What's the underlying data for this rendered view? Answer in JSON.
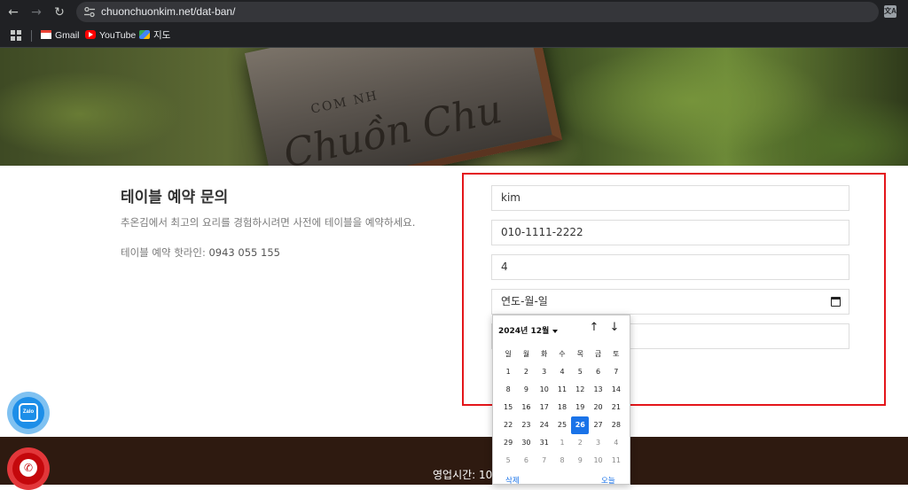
{
  "browser": {
    "url": "chuonchuonkim.net/dat-ban/",
    "translate_glyph": "文A",
    "back_glyph": "←",
    "forward_glyph": "→",
    "reload_glyph": "↻",
    "bookmarks": [
      {
        "label": "Gmail",
        "icon": "gmail-icon"
      },
      {
        "label": "YouTube",
        "icon": "youtube-icon"
      },
      {
        "label": "지도",
        "icon": "maps-icon"
      }
    ]
  },
  "hero": {
    "sign_line1": "COM NH",
    "sign_line2": "Chuồn Chu"
  },
  "intro": {
    "title": "테이블 예약 문의",
    "description": "추온김에서 최고의 요리를 경험하시려면 사전에 테이블을 예약하세요.",
    "hotline_label": "테이블 예약 핫라인: ",
    "hotline_number": "0943 055 155"
  },
  "form": {
    "name_value": "kim",
    "phone_value": "010-1111-2222",
    "guests_value": "4",
    "date_placeholder": "연도-월-일",
    "time_value": ""
  },
  "date_picker": {
    "month_label": "2024년 12월",
    "up_glyph": "↑",
    "down_glyph": "↓",
    "weekdays": [
      "일",
      "월",
      "화",
      "수",
      "목",
      "금",
      "토"
    ],
    "weeks": [
      [
        "1",
        "2",
        "3",
        "4",
        "5",
        "6",
        "7"
      ],
      [
        "8",
        "9",
        "10",
        "11",
        "12",
        "13",
        "14"
      ],
      [
        "15",
        "16",
        "17",
        "18",
        "19",
        "20",
        "21"
      ],
      [
        "22",
        "23",
        "24",
        "25",
        "26",
        "27",
        "28"
      ],
      [
        "29",
        "30",
        "31",
        "1",
        "2",
        "3",
        "4"
      ],
      [
        "5",
        "6",
        "7",
        "8",
        "9",
        "10",
        "11"
      ]
    ],
    "selected_day": "26",
    "clear_label": "삭제",
    "today_label": "오늘"
  },
  "floating": {
    "zalo_label": "Zalo",
    "call_glyph": "✆"
  },
  "footer": {
    "hours_label": "영업시간: 10:"
  },
  "colors": {
    "highlight_border": "#e4161b",
    "selected_day": "#1a73e8",
    "footer_bg": "#2e1a10"
  }
}
